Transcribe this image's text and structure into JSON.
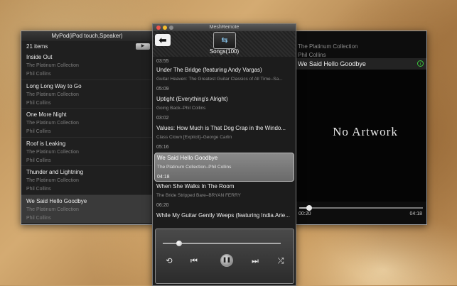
{
  "left_window": {
    "title": "MyPod(iPod touch,Speaker)",
    "count": "21 items",
    "play_button": "▶",
    "items": [
      {
        "title": "Inside Out",
        "album": "The Platinum Collection",
        "artist": "Phil Collins"
      },
      {
        "title": "Long Long Way to Go",
        "album": "The Platinum Collection",
        "artist": "Phil Collins"
      },
      {
        "title": "One More Night",
        "album": "The Platinum Collection",
        "artist": "Phil Collins"
      },
      {
        "title": "Roof is Leaking",
        "album": "The Platinum Collection",
        "artist": "Phil Collins"
      },
      {
        "title": "Thunder and Lightning",
        "album": "The Platinum Collection",
        "artist": "Phil Collins"
      },
      {
        "title": "We Said Hello Goodbye",
        "album": "The Platinum Collection",
        "artist": "Phil Collins"
      }
    ]
  },
  "center_window": {
    "window_title": "MeshRemote",
    "back_icon": "back-arrow-icon",
    "logo_icon": "meshremote-logo-icon",
    "songs_title": "Songs(100)",
    "first_duration": "03:55",
    "songs": [
      {
        "title": "Under The Bridge (featuring Andy Vargas)",
        "subtitle": "Guitar Heaven: The Greatest Guitar Classics of All Time–Sa...",
        "duration": "05:09"
      },
      {
        "title": "Uptight (Everything's Alright)",
        "subtitle": "Going Back–Phil Collins",
        "duration": "03:02"
      },
      {
        "title": "Values: How Much is That Dog Crap in the Windo...",
        "subtitle": "Class Clown [Explicit]–George Carlin",
        "duration": "05:16"
      },
      {
        "title": "We Said Hello Goodbye",
        "subtitle": "The Platinum Collection–Phil Collins",
        "duration": "04:18"
      },
      {
        "title": "When She Walks In The Room",
        "subtitle": "The Bride Stripped Bare–BRYAN FERRY",
        "duration": "06:20"
      },
      {
        "title": "While My Guitar Gently Weeps (featuring India.Arie...",
        "subtitle": "",
        "duration": ""
      }
    ],
    "controls": {
      "progress": 0.14,
      "repeat_icon": "repeat-icon",
      "prev_icon": "previous-track-icon",
      "pause_icon": "pause-icon",
      "next_icon": "next-track-icon",
      "shuffle_icon": "shuffle-icon"
    },
    "colors": {
      "accent": "#bdbdbd",
      "traffic_red": "#f0544b",
      "traffic_yellow": "#f5bd2c",
      "traffic_gray": "#8a8a8a"
    }
  },
  "right_window": {
    "album": "The Platinum Collection",
    "artist": "Phil Collins",
    "title": "We Said Hello Goodbye",
    "info_icon": "info-icon",
    "artwork_text": "No Artwork",
    "elapsed": "00:20",
    "total": "04:18",
    "progress": 0.08
  }
}
